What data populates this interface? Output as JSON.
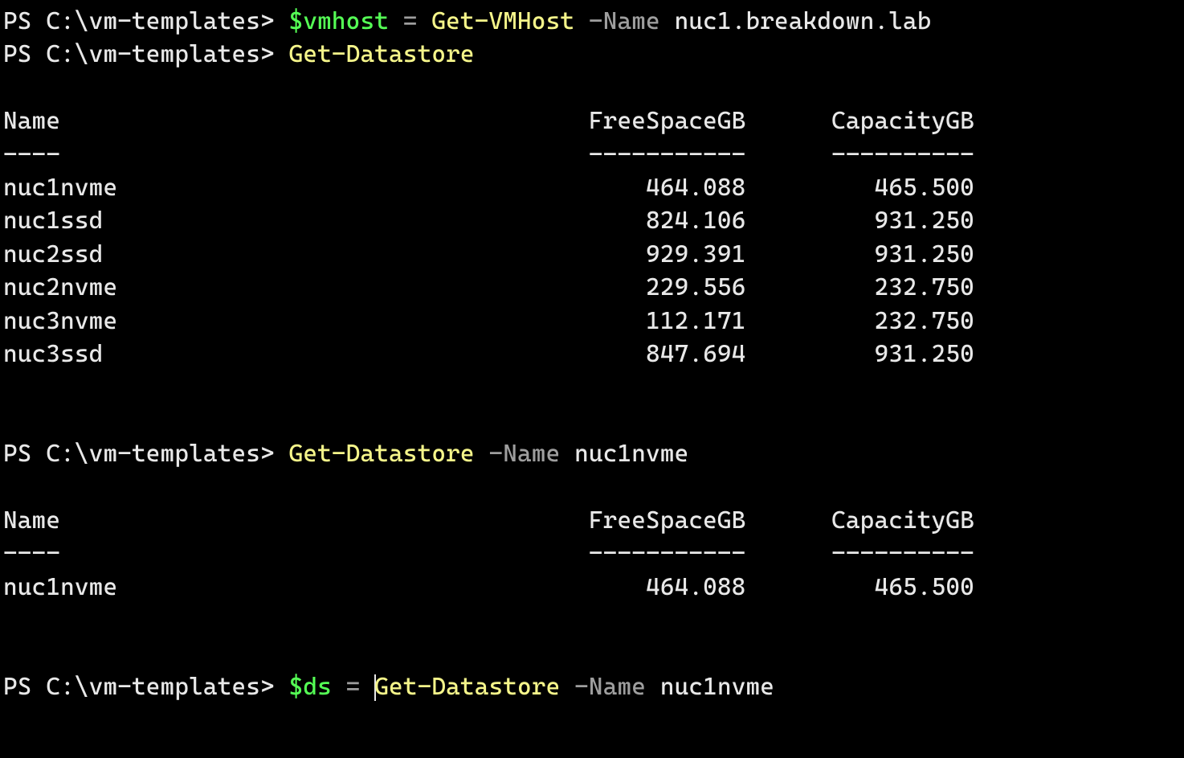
{
  "prompt": "PS C:\\vm-templates> ",
  "lines": {
    "l1": {
      "var": "$vmhost",
      "eq": " = ",
      "cmd": "Get-VMHost",
      "param": " -Name ",
      "arg": "nuc1.breakdown.lab"
    },
    "l2": {
      "cmd": "Get-Datastore"
    },
    "l3": {
      "cmd": "Get-Datastore",
      "param": " -Name ",
      "arg": "nuc1nvme"
    },
    "l4": {
      "var": "$ds",
      "eq": " = ",
      "cmd": "Get-Datastore",
      "param": " -Name ",
      "arg": "nuc1nvme"
    }
  },
  "table1": {
    "headers": {
      "name": "Name",
      "free": "FreeSpaceGB",
      "cap": "CapacityGB"
    },
    "dashes": {
      "name": "----",
      "free": "-----------",
      "cap": "----------"
    },
    "rows": [
      {
        "name": "nuc1nvme",
        "free": "464.088",
        "cap": "465.500"
      },
      {
        "name": "nuc1ssd",
        "free": "824.106",
        "cap": "931.250"
      },
      {
        "name": "nuc2ssd",
        "free": "929.391",
        "cap": "931.250"
      },
      {
        "name": "nuc2nvme",
        "free": "229.556",
        "cap": "232.750"
      },
      {
        "name": "nuc3nvme",
        "free": "112.171",
        "cap": "232.750"
      },
      {
        "name": "nuc3ssd",
        "free": "847.694",
        "cap": "931.250"
      }
    ]
  },
  "table2": {
    "headers": {
      "name": "Name",
      "free": "FreeSpaceGB",
      "cap": "CapacityGB"
    },
    "dashes": {
      "name": "----",
      "free": "-----------",
      "cap": "----------"
    },
    "rows": [
      {
        "name": "nuc1nvme",
        "free": "464.088",
        "cap": "465.500"
      }
    ]
  },
  "columns": {
    "nameWidth": 38,
    "freeWidth": 14,
    "capWidth": 16
  }
}
